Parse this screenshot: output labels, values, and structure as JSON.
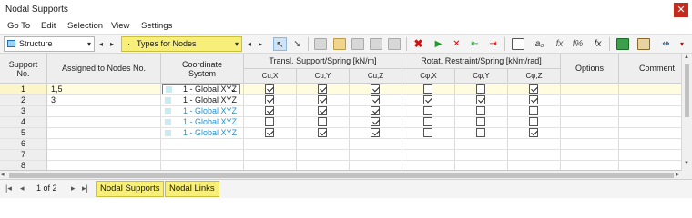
{
  "window": {
    "title": "Nodal Supports",
    "close_icon": "close-icon"
  },
  "menu": [
    "Go To",
    "Edit",
    "Selection",
    "View",
    "Settings"
  ],
  "toolbar": {
    "structure_combo": "Structure",
    "types_combo": "Types for Nodes"
  },
  "table": {
    "headers": {
      "support_no": [
        "Support",
        "No."
      ],
      "assigned": "Assigned to Nodes No.",
      "coord": [
        "Coordinate",
        "System"
      ],
      "transl_group": "Transl. Support/Spring [kN/m]",
      "rotat_group": "Rotat. Restraint/Spring [kNm/rad]",
      "options": "Options",
      "comment": "Comment",
      "sub": [
        "Cu,X",
        "Cu,Y",
        "Cu,Z",
        "Cφ,X",
        "Cφ,Y",
        "Cφ,Z"
      ]
    },
    "rows": [
      {
        "no": "1",
        "nodes": "1,5",
        "cs": "1 - Global XYZ",
        "cs_color": "#c9ecf4",
        "flags": [
          true,
          true,
          true,
          false,
          false,
          true
        ]
      },
      {
        "no": "2",
        "nodes": "3",
        "cs": "1 - Global XYZ",
        "cs_color": "#c9ecf4",
        "flags": [
          true,
          true,
          true,
          true,
          true,
          true
        ]
      },
      {
        "no": "3",
        "nodes": "",
        "cs": "1 - Global XYZ",
        "cs_color": "#c9ecf4",
        "flags": [
          true,
          true,
          true,
          false,
          false,
          false
        ]
      },
      {
        "no": "4",
        "nodes": "",
        "cs": "1 - Global XYZ",
        "cs_color": "#c9ecf4",
        "flags": [
          false,
          false,
          true,
          false,
          false,
          false
        ]
      },
      {
        "no": "5",
        "nodes": "",
        "cs": "1 - Global XYZ",
        "cs_color": "#c9ecf4",
        "flags": [
          true,
          true,
          true,
          false,
          false,
          true
        ]
      },
      {
        "no": "6",
        "nodes": "",
        "cs": "",
        "flags": []
      },
      {
        "no": "7",
        "nodes": "",
        "cs": "",
        "flags": []
      },
      {
        "no": "8",
        "nodes": "",
        "cs": "",
        "flags": []
      }
    ]
  },
  "status": {
    "page": "1 of 2",
    "tabs": [
      "Nodal Supports",
      "Nodal Links"
    ]
  }
}
